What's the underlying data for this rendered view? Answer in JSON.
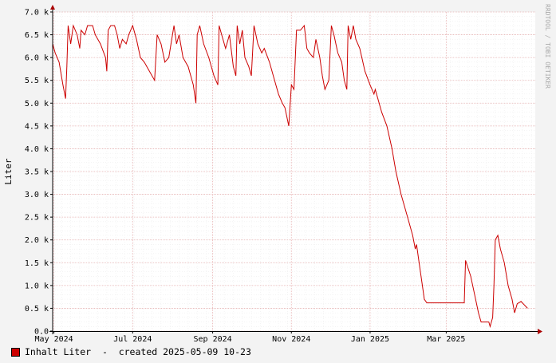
{
  "chart_data": {
    "type": "line",
    "ylabel": "Liter",
    "ylim": [
      0,
      7000
    ],
    "yticks": [
      0,
      500,
      1000,
      1500,
      2000,
      2500,
      3000,
      3500,
      4000,
      4500,
      5000,
      5500,
      6000,
      6500,
      7000
    ],
    "ytick_labels": [
      "0.0",
      "0.5 k",
      "1.0 k",
      "1.5 k",
      "2.0 k",
      "2.5 k",
      "3.0 k",
      "3.5 k",
      "4.0 k",
      "4.5 k",
      "5.0 k",
      "5.5 k",
      "6.0 k",
      "6.5 k",
      "7.0 k"
    ],
    "xlim": [
      "2024-04-30",
      "2025-05-09"
    ],
    "xticks": [
      "2024-05-01",
      "2024-07-01",
      "2024-09-01",
      "2024-11-01",
      "2025-01-01",
      "2025-03-01"
    ],
    "xtick_labels": [
      "May 2024",
      "Jul 2024",
      "Sep 2024",
      "Nov 2024",
      "Jan 2025",
      "Mar 2025"
    ],
    "grid": true,
    "legend_position": "bottom-left",
    "colors": {
      "line": "#cc0000",
      "background": "#f3f3f3",
      "plot": "#ffffff",
      "grid": "#e8b4b4",
      "axis": "#000000"
    },
    "series": [
      {
        "name": "Inhalt Liter",
        "points": [
          [
            "2024-04-30",
            6300
          ],
          [
            "2024-05-02",
            6100
          ],
          [
            "2024-05-05",
            5900
          ],
          [
            "2024-05-08",
            5400
          ],
          [
            "2024-05-10",
            5100
          ],
          [
            "2024-05-11",
            5800
          ],
          [
            "2024-05-12",
            6700
          ],
          [
            "2024-05-14",
            6300
          ],
          [
            "2024-05-16",
            6700
          ],
          [
            "2024-05-19",
            6500
          ],
          [
            "2024-05-21",
            6200
          ],
          [
            "2024-05-22",
            6600
          ],
          [
            "2024-05-25",
            6500
          ],
          [
            "2024-05-27",
            6700
          ],
          [
            "2024-05-31",
            6700
          ],
          [
            "2024-06-02",
            6500
          ],
          [
            "2024-06-06",
            6300
          ],
          [
            "2024-06-10",
            6000
          ],
          [
            "2024-06-11",
            5700
          ],
          [
            "2024-06-12",
            6600
          ],
          [
            "2024-06-14",
            6700
          ],
          [
            "2024-06-17",
            6700
          ],
          [
            "2024-06-19",
            6500
          ],
          [
            "2024-06-21",
            6200
          ],
          [
            "2024-06-23",
            6400
          ],
          [
            "2024-06-26",
            6300
          ],
          [
            "2024-06-28",
            6500
          ],
          [
            "2024-07-01",
            6700
          ],
          [
            "2024-07-04",
            6400
          ],
          [
            "2024-07-07",
            6000
          ],
          [
            "2024-07-10",
            5900
          ],
          [
            "2024-07-14",
            5700
          ],
          [
            "2024-07-18",
            5500
          ],
          [
            "2024-07-20",
            6500
          ],
          [
            "2024-07-23",
            6300
          ],
          [
            "2024-07-26",
            5900
          ],
          [
            "2024-07-29",
            6000
          ],
          [
            "2024-08-02",
            6700
          ],
          [
            "2024-08-04",
            6300
          ],
          [
            "2024-08-06",
            6500
          ],
          [
            "2024-08-09",
            6000
          ],
          [
            "2024-08-13",
            5800
          ],
          [
            "2024-08-17",
            5400
          ],
          [
            "2024-08-19",
            5000
          ],
          [
            "2024-08-20",
            6500
          ],
          [
            "2024-08-22",
            6700
          ],
          [
            "2024-08-25",
            6300
          ],
          [
            "2024-08-29",
            6000
          ],
          [
            "2024-09-02",
            5600
          ],
          [
            "2024-09-05",
            5400
          ],
          [
            "2024-09-06",
            6700
          ],
          [
            "2024-09-08",
            6500
          ],
          [
            "2024-09-11",
            6200
          ],
          [
            "2024-09-14",
            6500
          ],
          [
            "2024-09-17",
            5800
          ],
          [
            "2024-09-19",
            5600
          ],
          [
            "2024-09-20",
            6700
          ],
          [
            "2024-09-22",
            6300
          ],
          [
            "2024-09-24",
            6600
          ],
          [
            "2024-09-26",
            6000
          ],
          [
            "2024-09-29",
            5800
          ],
          [
            "2024-10-01",
            5600
          ],
          [
            "2024-10-03",
            6700
          ],
          [
            "2024-10-06",
            6300
          ],
          [
            "2024-10-09",
            6100
          ],
          [
            "2024-10-11",
            6200
          ],
          [
            "2024-10-15",
            5900
          ],
          [
            "2024-10-18",
            5600
          ],
          [
            "2024-10-22",
            5200
          ],
          [
            "2024-10-25",
            5000
          ],
          [
            "2024-10-27",
            4900
          ],
          [
            "2024-10-30",
            4500
          ],
          [
            "2024-11-01",
            5400
          ],
          [
            "2024-11-03",
            5300
          ],
          [
            "2024-11-05",
            6600
          ],
          [
            "2024-11-08",
            6600
          ],
          [
            "2024-11-11",
            6700
          ],
          [
            "2024-11-13",
            6200
          ],
          [
            "2024-11-15",
            6100
          ],
          [
            "2024-11-18",
            6000
          ],
          [
            "2024-11-20",
            6400
          ],
          [
            "2024-11-23",
            6000
          ],
          [
            "2024-11-25",
            5600
          ],
          [
            "2024-11-27",
            5300
          ],
          [
            "2024-11-30",
            5500
          ],
          [
            "2024-12-02",
            6700
          ],
          [
            "2024-12-04",
            6500
          ],
          [
            "2024-12-07",
            6100
          ],
          [
            "2024-12-10",
            5900
          ],
          [
            "2024-12-12",
            5500
          ],
          [
            "2024-12-14",
            5300
          ],
          [
            "2024-12-15",
            6700
          ],
          [
            "2024-12-17",
            6400
          ],
          [
            "2024-12-19",
            6700
          ],
          [
            "2024-12-21",
            6400
          ],
          [
            "2024-12-24",
            6200
          ],
          [
            "2024-12-28",
            5700
          ],
          [
            "2025-01-01",
            5400
          ],
          [
            "2025-01-04",
            5200
          ],
          [
            "2025-01-05",
            5300
          ],
          [
            "2025-01-10",
            4800
          ],
          [
            "2025-01-14",
            4500
          ],
          [
            "2025-01-18",
            4000
          ],
          [
            "2025-01-21",
            3500
          ],
          [
            "2025-01-25",
            3000
          ],
          [
            "2025-01-30",
            2500
          ],
          [
            "2025-02-03",
            2100
          ],
          [
            "2025-02-05",
            1800
          ],
          [
            "2025-02-06",
            1900
          ],
          [
            "2025-02-08",
            1500
          ],
          [
            "2025-02-11",
            900
          ],
          [
            "2025-02-12",
            700
          ],
          [
            "2025-02-14",
            620
          ],
          [
            "2025-03-15",
            620
          ],
          [
            "2025-03-16",
            1550
          ],
          [
            "2025-03-20",
            1200
          ],
          [
            "2025-03-23",
            800
          ],
          [
            "2025-03-26",
            400
          ],
          [
            "2025-03-28",
            200
          ],
          [
            "2025-04-03",
            200
          ],
          [
            "2025-04-04",
            100
          ],
          [
            "2025-04-06",
            300
          ],
          [
            "2025-04-07",
            1000
          ],
          [
            "2025-04-08",
            2000
          ],
          [
            "2025-04-10",
            2100
          ],
          [
            "2025-04-12",
            1800
          ],
          [
            "2025-04-15",
            1500
          ],
          [
            "2025-04-18",
            1000
          ],
          [
            "2025-04-21",
            700
          ],
          [
            "2025-04-23",
            400
          ],
          [
            "2025-04-25",
            600
          ],
          [
            "2025-04-28",
            650
          ],
          [
            "2025-05-03",
            500
          ]
        ]
      }
    ]
  },
  "legend": {
    "label": "Inhalt Liter",
    "created": "  -  created 2025-05-09 10-23"
  },
  "watermark": "RRDTOOL / TOBI OETIKER"
}
